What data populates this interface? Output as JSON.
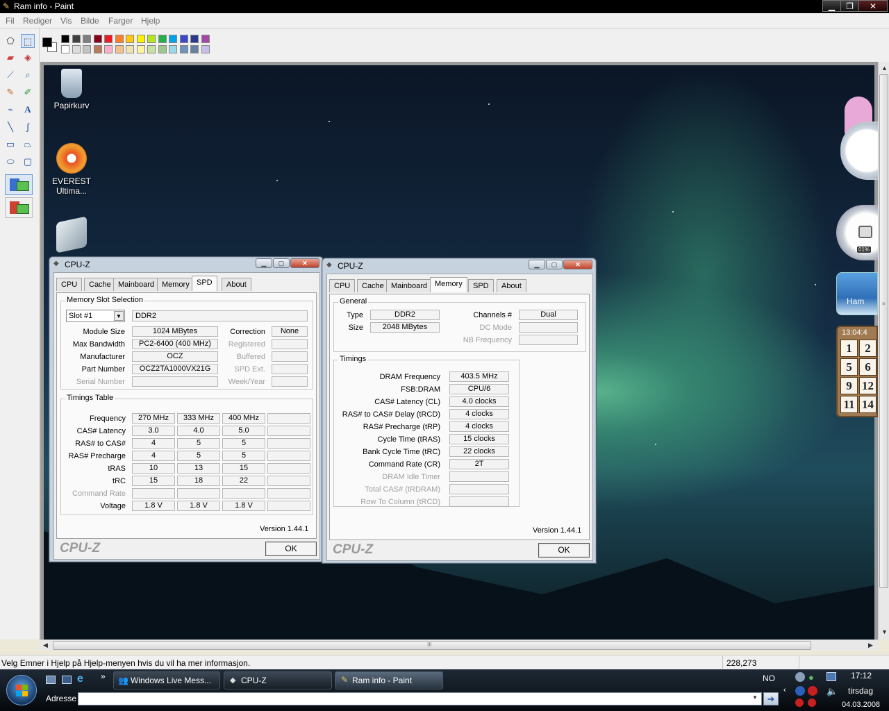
{
  "paint": {
    "title": "Ram info - Paint",
    "menus": [
      "Fil",
      "Rediger",
      "Vis",
      "Bilde",
      "Farger",
      "Hjelp"
    ],
    "primary_color": "#000000",
    "secondary_color": "#ffffff",
    "palette": [
      "#000000",
      "#7f7f7f",
      "#880015",
      "#ed1c24",
      "#ff7f27",
      "#fff200",
      "#22b14c",
      "#00a2e8",
      "#3f48cc",
      "#a349a4",
      "#ffffff",
      "#c3c3c3",
      "#b97a57",
      "#ffaec9",
      "#ffc90e",
      "#efe4b0",
      "#b5e61d",
      "#99d9ea",
      "#7092be",
      "#c8bfe7"
    ],
    "tools": [
      "free-select-icon",
      "rect-select-icon",
      "eraser-icon",
      "fill-icon",
      "eyedropper-icon",
      "magnifier-icon",
      "pencil-icon",
      "brush-icon",
      "airbrush-icon",
      "text-icon",
      "line-icon",
      "curve-icon",
      "rectangle-icon",
      "polygon-icon",
      "ellipse-icon",
      "rounded-rect-icon"
    ],
    "status_text": "Velg Emner i Hjelp på Hjelp-menyen hvis du vil ha mer informasjon.",
    "coordinates": "228,273",
    "hscroll_grip": "III"
  },
  "desktop": {
    "icons": [
      {
        "label": "Papirkurv",
        "icon": "recycle-bin-icon"
      },
      {
        "label": "EVEREST Ultima...",
        "icon": "everest-icon"
      },
      {
        "label": "",
        "icon": "network-shield-icon"
      }
    ],
    "gadgets": {
      "cpu_meter": "01%",
      "clock_time": "13:04:4",
      "weather_text": "Ham",
      "puzzle_numbers": [
        "1",
        "2",
        "5",
        "6",
        "9",
        "12",
        "11",
        "14"
      ]
    }
  },
  "cpuz_spd": {
    "title": "CPU-Z",
    "tabs": [
      "CPU",
      "Cache",
      "Mainboard",
      "Memory",
      "SPD",
      "About"
    ],
    "active_tab": "SPD",
    "slot_group": "Memory Slot Selection",
    "slot": "Slot #1",
    "slot_type": "DDR2",
    "rows": [
      {
        "label": "Module Size",
        "value": "1024 MBytes",
        "rlabel": "Correction",
        "rvalue": "None",
        "dim": false,
        "rdim": false
      },
      {
        "label": "Max Bandwidth",
        "value": "PC2-6400 (400 MHz)",
        "rlabel": "Registered",
        "rvalue": "",
        "dim": false,
        "rdim": true
      },
      {
        "label": "Manufacturer",
        "value": "OCZ",
        "rlabel": "Buffered",
        "rvalue": "",
        "dim": false,
        "rdim": true
      },
      {
        "label": "Part Number",
        "value": "OCZ2TA1000VX21G",
        "rlabel": "SPD Ext.",
        "rvalue": "",
        "dim": false,
        "rdim": true
      },
      {
        "label": "Serial Number",
        "value": "",
        "rlabel": "Week/Year",
        "rvalue": "",
        "dim": true,
        "rdim": true
      }
    ],
    "timings_group": "Timings Table",
    "timings": [
      {
        "label": "Frequency",
        "values": [
          "270 MHz",
          "333 MHz",
          "400 MHz",
          ""
        ],
        "dim": false
      },
      {
        "label": "CAS# Latency",
        "values": [
          "3.0",
          "4.0",
          "5.0",
          ""
        ],
        "dim": false
      },
      {
        "label": "RAS# to CAS#",
        "values": [
          "4",
          "5",
          "5",
          ""
        ],
        "dim": false
      },
      {
        "label": "RAS# Precharge",
        "values": [
          "4",
          "5",
          "5",
          ""
        ],
        "dim": false
      },
      {
        "label": "tRAS",
        "values": [
          "10",
          "13",
          "15",
          ""
        ],
        "dim": false
      },
      {
        "label": "tRC",
        "values": [
          "15",
          "18",
          "22",
          ""
        ],
        "dim": false
      },
      {
        "label": "Command Rate",
        "values": [
          "",
          "",
          "",
          ""
        ],
        "dim": true
      },
      {
        "label": "Voltage",
        "values": [
          "1.8 V",
          "1.8 V",
          "1.8 V",
          ""
        ],
        "dim": false
      }
    ],
    "version": "Version 1.44.1",
    "brand": "CPU-Z",
    "ok": "OK"
  },
  "cpuz_mem": {
    "title": "CPU-Z",
    "tabs": [
      "CPU",
      "Cache",
      "Mainboard",
      "Memory",
      "SPD",
      "About"
    ],
    "active_tab": "Memory",
    "general_group": "General",
    "type_label": "Type",
    "type_value": "DDR2",
    "size_label": "Size",
    "size_value": "2048 MBytes",
    "channels_label": "Channels #",
    "channels_value": "Dual",
    "dcmode_label": "DC Mode",
    "dcmode_value": "",
    "nbfreq_label": "NB Frequency",
    "nbfreq_value": "",
    "timings_group": "Timings",
    "timings": [
      {
        "label": "DRAM Frequency",
        "value": "403.5 MHz",
        "dim": false
      },
      {
        "label": "FSB:DRAM",
        "value": "CPU/6",
        "dim": false
      },
      {
        "label": "CAS# Latency (CL)",
        "value": "4.0 clocks",
        "dim": false
      },
      {
        "label": "RAS# to CAS# Delay (tRCD)",
        "value": "4 clocks",
        "dim": false
      },
      {
        "label": "RAS# Precharge (tRP)",
        "value": "4 clocks",
        "dim": false
      },
      {
        "label": "Cycle Time (tRAS)",
        "value": "15 clocks",
        "dim": false
      },
      {
        "label": "Bank Cycle Time (tRC)",
        "value": "22 clocks",
        "dim": false
      },
      {
        "label": "Command Rate (CR)",
        "value": "2T",
        "dim": false
      },
      {
        "label": "DRAM Idle Timer",
        "value": "",
        "dim": true
      },
      {
        "label": "Total CAS# (tRDRAM)",
        "value": "",
        "dim": true
      },
      {
        "label": "Row To Column (tRCD)",
        "value": "",
        "dim": true
      }
    ],
    "version": "Version 1.44.1",
    "brand": "CPU-Z",
    "ok": "OK"
  },
  "taskbar": {
    "buttons": [
      "Windows Live Mess...",
      "CPU-Z",
      "Ram info - Paint"
    ],
    "active": "Ram info - Paint",
    "overflow": "»",
    "address_label": "Adresse",
    "language": "NO",
    "time": "17:12",
    "day": "tirsdag",
    "date": "04.03.2008"
  }
}
